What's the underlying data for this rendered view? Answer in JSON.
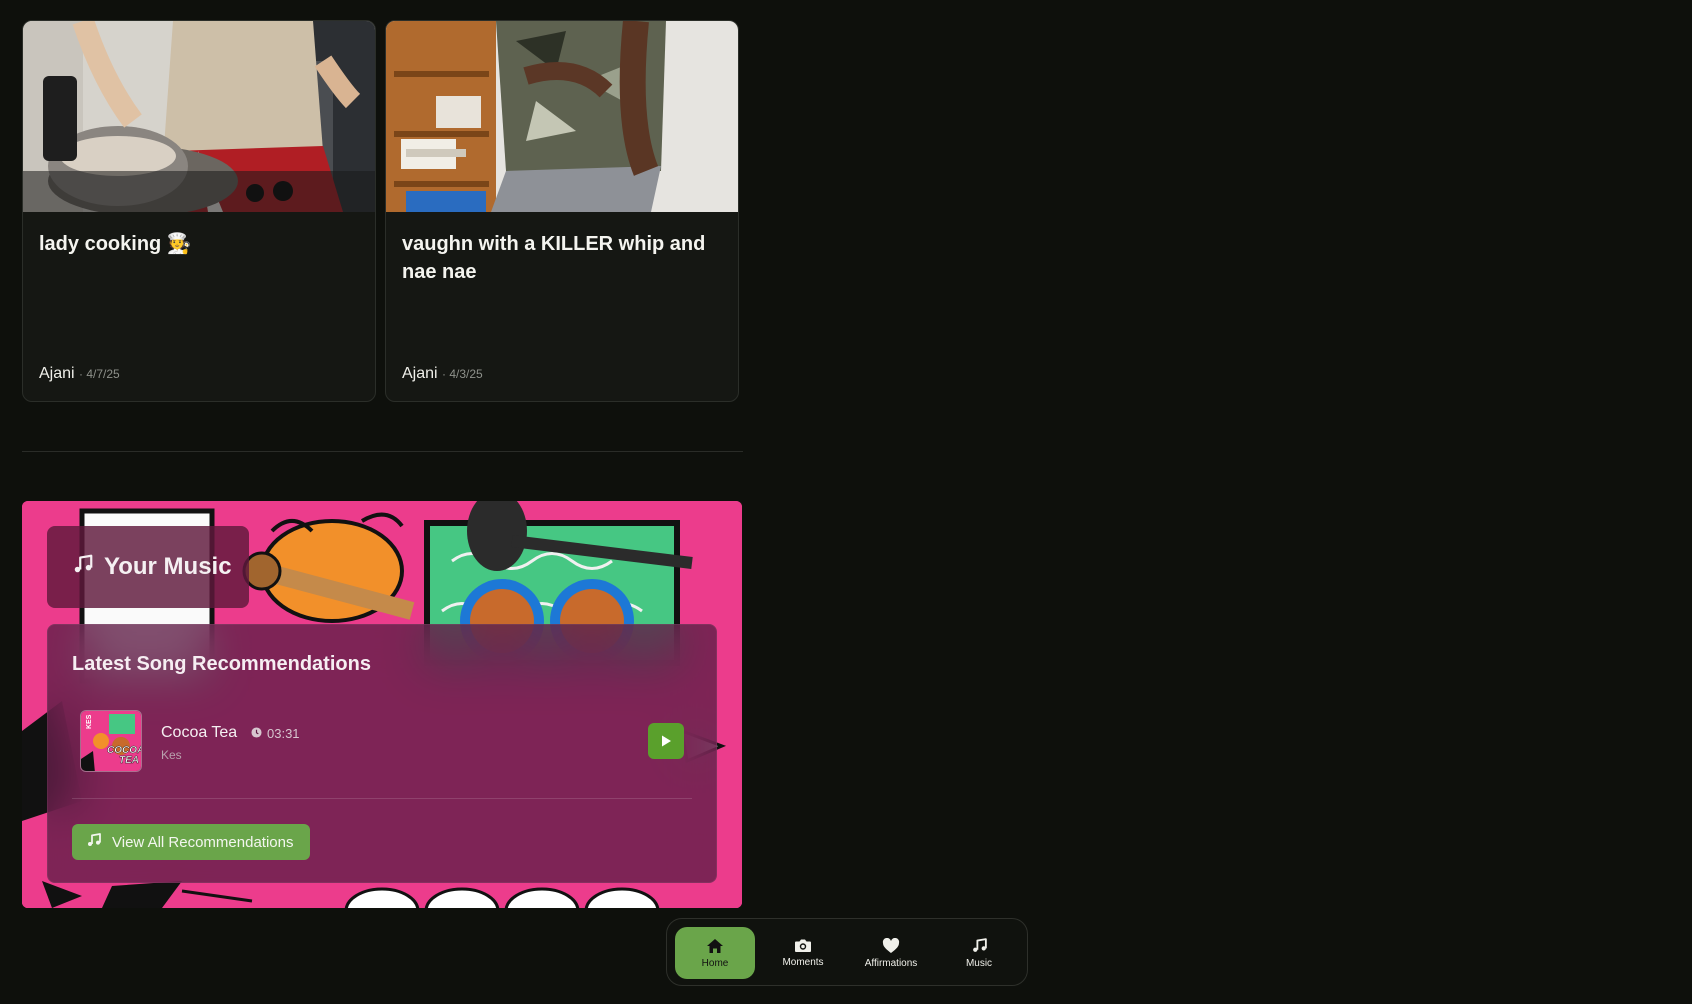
{
  "cards": [
    {
      "title": "lady cooking 🧑‍🍳",
      "author": "Ajani",
      "date": "· 4/7/25"
    },
    {
      "title": "vaughn with a KILLER whip and nae nae",
      "author": "Ajani",
      "date": "· 4/3/25"
    }
  ],
  "music": {
    "section_title": "Your Music",
    "panel_title": "Latest Song Recommendations",
    "song": {
      "title": "Cocoa Tea",
      "duration": "03:31",
      "artist": "Kes",
      "cover_text_1": "COCOA",
      "cover_text_2": "TEA",
      "cover_text_3": "KES"
    },
    "view_all_label": "View All Recommendations"
  },
  "nav": {
    "items": [
      {
        "label": "Home",
        "icon": "home-icon",
        "active": true
      },
      {
        "label": "Moments",
        "icon": "camera-icon",
        "active": false
      },
      {
        "label": "Affirmations",
        "icon": "heart-icon",
        "active": false
      },
      {
        "label": "Music",
        "icon": "music-note-icon",
        "active": false
      }
    ]
  },
  "colors": {
    "accent": "#6aa54a",
    "background": "#0e100c",
    "card": "#151713",
    "music_bg": "#ec3c8c",
    "panel": "#5f1e46"
  }
}
